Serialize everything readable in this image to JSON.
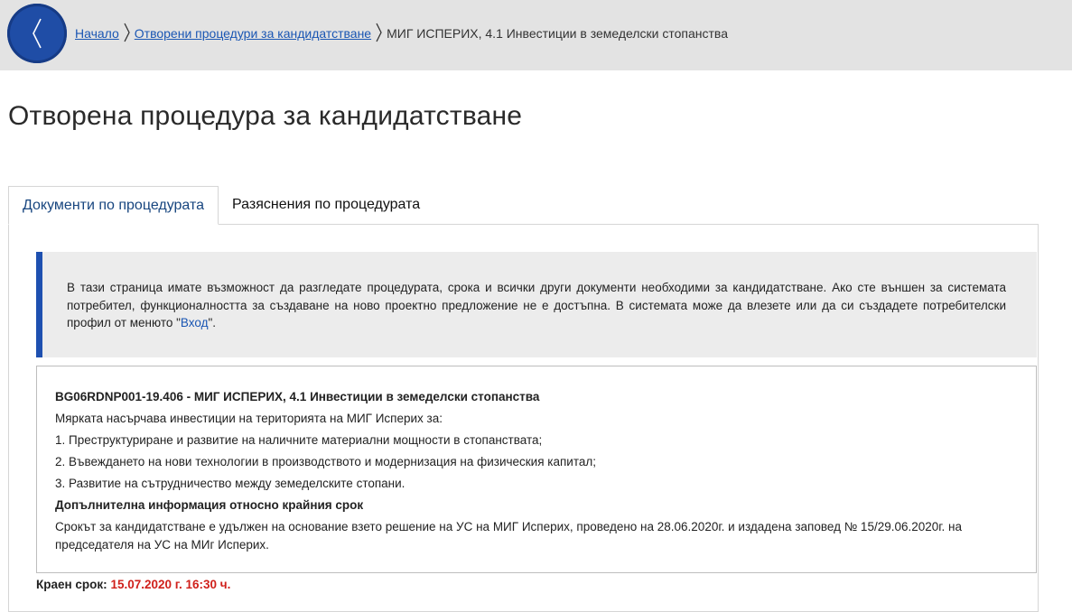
{
  "breadcrumb": {
    "home": "Начало",
    "open_procedures": "Отворени процедури за кандидатстване",
    "current": "МИГ ИСПЕРИХ, 4.1 Инвестиции в земеделски стопанства"
  },
  "page": {
    "title": "Отворена процедура за кандидатстване"
  },
  "tabs": [
    {
      "label": "Документи по процедурата",
      "active": true
    },
    {
      "label": "Разяснения по процедурата",
      "active": false
    }
  ],
  "alert": {
    "text_before": "В тази страница имате възможност да разгледате процедурата, срока и всички други документи необходими за кандидатстване. Ако сте външен за системата потребител, функционалността за създаване на ново проектно предложение не е достъпна. В системата може да влезете или да си създадете потребителски профил от менюто \"",
    "link": "Вход",
    "text_after": "\"."
  },
  "procedure": {
    "heading": "BG06RDNP001-19.406 - МИГ ИСПЕРИХ, 4.1 Инвестиции в земеделски стопанства",
    "intro": "Мярката насърчава инвестиции на територията на МИГ Исперих за:",
    "items": [
      "1. Преструктуриране и развитие на наличните материални мощности в стопанствата;",
      "2. Въвеждането на нови технологии в производството и модернизация на физическия капитал;",
      "3. Развитие на сътрудничество между земеделските стопани."
    ],
    "extra_heading": "Допълнителна информация относно крайния срок",
    "extra_text": "Срокът за кандидатстване е удължен на основание взето решение на УС на МИГ Исперих, проведено на 28.06.2020г. и издадена заповед № 15/29.06.2020г. на председателя на УС на МИг Исперих."
  },
  "deadline": {
    "label": "Краен срок:",
    "value": "15.07.2020 г. 16:30 ч."
  },
  "colors": {
    "accent": "#1e50b0",
    "link": "#1a56b3",
    "deadline": "#d0201b"
  }
}
